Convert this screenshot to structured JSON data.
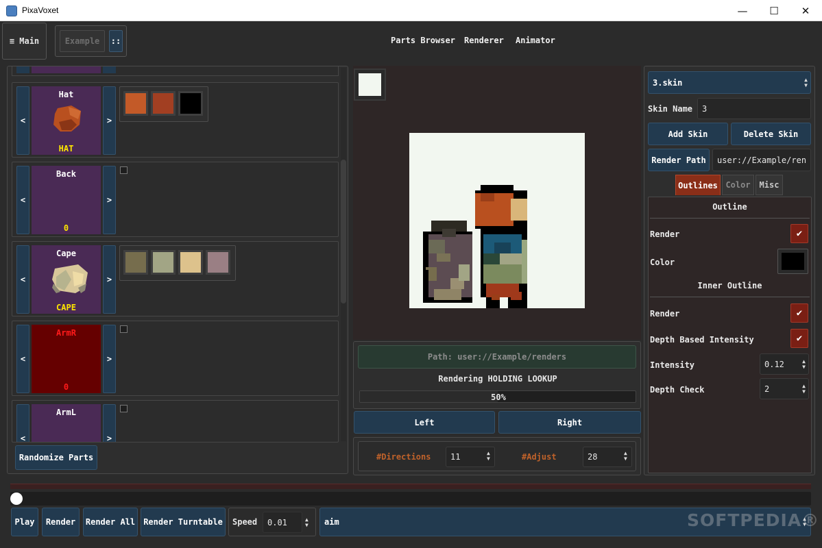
{
  "window": {
    "title": "PixaVoxet",
    "minimize": "—",
    "maximize": "☐",
    "close": "✕"
  },
  "menubar": {
    "main_label": "≡ Main",
    "project": "Example",
    "project_menu": "::",
    "nav": [
      "Parts Browser",
      "Renderer",
      "Animator"
    ]
  },
  "parts": [
    {
      "name": "Hat",
      "value": "HAT",
      "tile_color": "#4a2a55",
      "value_color": "#ffe600",
      "name_color": "#ffffff",
      "icon": "hat-icon",
      "swatches": [
        "#c35a28",
        "#a23f22",
        "#000000"
      ]
    },
    {
      "name": "Back",
      "value": "0",
      "tile_color": "#4a2a55",
      "value_color": "#ffe600",
      "name_color": "#ffffff",
      "icon": "",
      "swatches": []
    },
    {
      "name": "Cape",
      "value": "CAPE",
      "tile_color": "#4a2a55",
      "value_color": "#ffe600",
      "name_color": "#ffffff",
      "icon": "cape-icon",
      "swatches": [
        "#766d4d",
        "#a2a585",
        "#ddc28c",
        "#9a7f84"
      ]
    },
    {
      "name": "ArmR",
      "value": "0",
      "tile_color": "#650000",
      "value_color": "#ff1a1a",
      "name_color": "#ff1a1a",
      "icon": "",
      "swatches": []
    },
    {
      "name": "ArmL",
      "value": "",
      "tile_color": "#4a2a55",
      "value_color": "#ffe600",
      "name_color": "#ffffff",
      "icon": "",
      "swatches": []
    }
  ],
  "part_prev": "<",
  "part_next": ">",
  "randomize_label": "Randomize Parts",
  "renderer": {
    "bg_color": "#f2f7f0",
    "path_label": "Path: user://Example/renders",
    "status": "Rendering HOLDING LOOKUP",
    "progress": 0.5,
    "progress_label": "50%",
    "left_label": "Left",
    "right_label": "Right",
    "directions_label": "#Directions",
    "directions_value": "11",
    "adjust_label": "#Adjust",
    "adjust_value": "28"
  },
  "skin": {
    "selected": "3.skin",
    "name_label": "Skin Name",
    "name_value": "3",
    "add_label": "Add Skin",
    "delete_label": "Delete Skin",
    "render_path_label": "Render Path",
    "render_path_value": "user://Example/ren",
    "tabs": [
      "Outlines",
      "Color",
      "Misc"
    ],
    "outline_header": "Outline",
    "render_label": "Render",
    "render_checked": true,
    "color_label": "Color",
    "outline_color": "#000000",
    "inner_header": "Inner Outline",
    "inner_render_label": "Render",
    "inner_render_checked": true,
    "depth_label": "Depth Based Intensity",
    "depth_checked": true,
    "intensity_label": "Intensity",
    "intensity_value": "0.12",
    "depth_check_label": "Depth Check",
    "depth_check_value": "2",
    "check_mark": "✔"
  },
  "animator": {
    "timeline_position": 0,
    "play_label": "Play",
    "render_label": "Render",
    "render_all_label": "Render All",
    "render_turntable_label": "Render Turntable",
    "speed_label": "Speed",
    "speed_value": "0.01",
    "animation_value": "aim"
  },
  "watermark": "SOFTPEDIA®",
  "colors": {
    "accent": "#7a1f14",
    "button": "#223a4f",
    "label_orange": "#c0622a",
    "tab_active": "#8a2e18"
  }
}
